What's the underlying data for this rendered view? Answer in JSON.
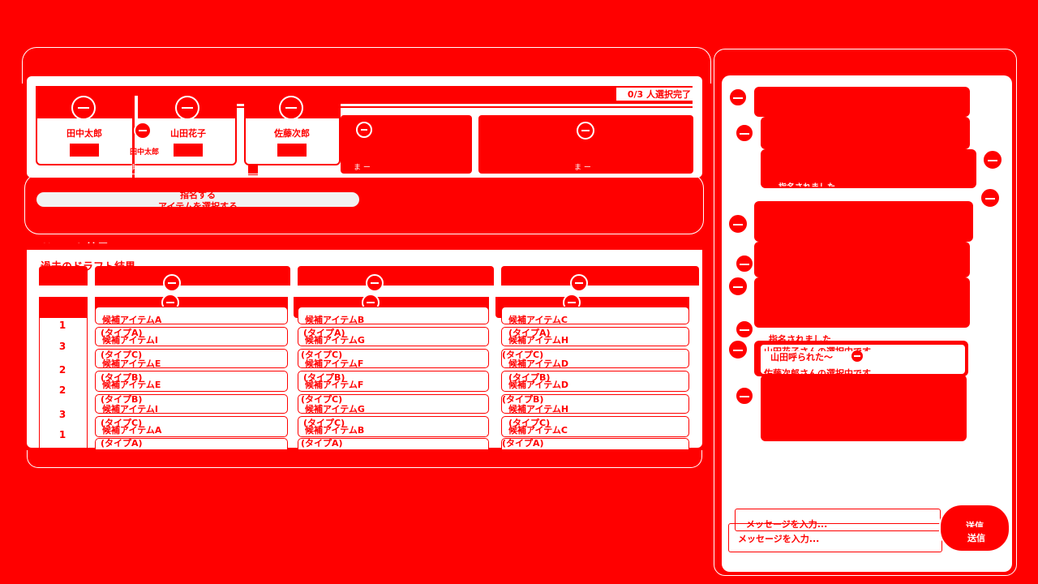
{
  "header": {
    "selection_status": "0/3 人選択完了"
  },
  "players": [
    {
      "name": "田中太郎",
      "button": ""
    },
    {
      "name": "山田花子",
      "button": ""
    },
    {
      "name": "佐藤次郎",
      "button": ""
    }
  ],
  "ghost_player_label": "田中太郎",
  "ghost_row_marks": [
    "ま ー",
    "ま ー",
    "ま ー"
  ],
  "action_button": {
    "line1": "指名する",
    "line2": "アイテムを選択する"
  },
  "draft": {
    "section_title": "ドラフト結果",
    "subtitle": "過去のドラフト結果",
    "columns": [
      {
        "rows": [
          {
            "name": "候補アイテムA",
            "type": "(タイプA)"
          },
          {
            "name": "候補アイテムI",
            "type": "(タイプC)"
          },
          {
            "name": "候補アイテムE",
            "type": "(タイプB)"
          },
          {
            "name": "候補アイテムE",
            "type": "(タイプB)"
          },
          {
            "name": "候補アイテムI",
            "type": "(タイプC)"
          },
          {
            "name": "候補アイテムA",
            "type": "(タイプA)"
          }
        ]
      },
      {
        "rows": [
          {
            "name": "候補アイテムB",
            "type": "(タイプA)"
          },
          {
            "name": "候補アイテムG",
            "type": "(タイプC)"
          },
          {
            "name": "候補アイテムF",
            "type": "(タイプB)"
          },
          {
            "name": "候補アイテムF",
            "type": "(タイプC)"
          },
          {
            "name": "候補アイテムG",
            "type": "(タイプC)"
          },
          {
            "name": "候補アイテムB",
            "type": "(タイプA)"
          }
        ]
      },
      {
        "rows": [
          {
            "name": "候補アイテムC",
            "type": "(タイプA)"
          },
          {
            "name": "候補アイテムH",
            "type": "(タイプC)"
          },
          {
            "name": "候補アイテムD",
            "type": "(タイプB)"
          },
          {
            "name": "候補アイテムD",
            "type": "(タイプB)"
          },
          {
            "name": "候補アイテムH",
            "type": "(タイプC)"
          },
          {
            "name": "候補アイテムC",
            "type": "(タイプA)"
          }
        ]
      }
    ],
    "ranks": [
      "1",
      "3",
      "2",
      "2",
      "3",
      "1"
    ]
  },
  "chat": {
    "message_fragment_1": "指名されました",
    "message_fragment_2": "山田花子さんの選択中です",
    "message_selected": "指名されました",
    "message_line1": "山田花子さんの選択中です",
    "message_called": "山田呼られた〜",
    "message_sato": "佐藤次郎さんの選択中です",
    "input_placeholder": "メッセージを入力...",
    "input_placeholder_ghost": "メッセージを入力...",
    "send_label": "送信",
    "send_label_ghost": "送信"
  },
  "colors": {
    "primary": "#ff0000",
    "surface": "#ffffff"
  }
}
